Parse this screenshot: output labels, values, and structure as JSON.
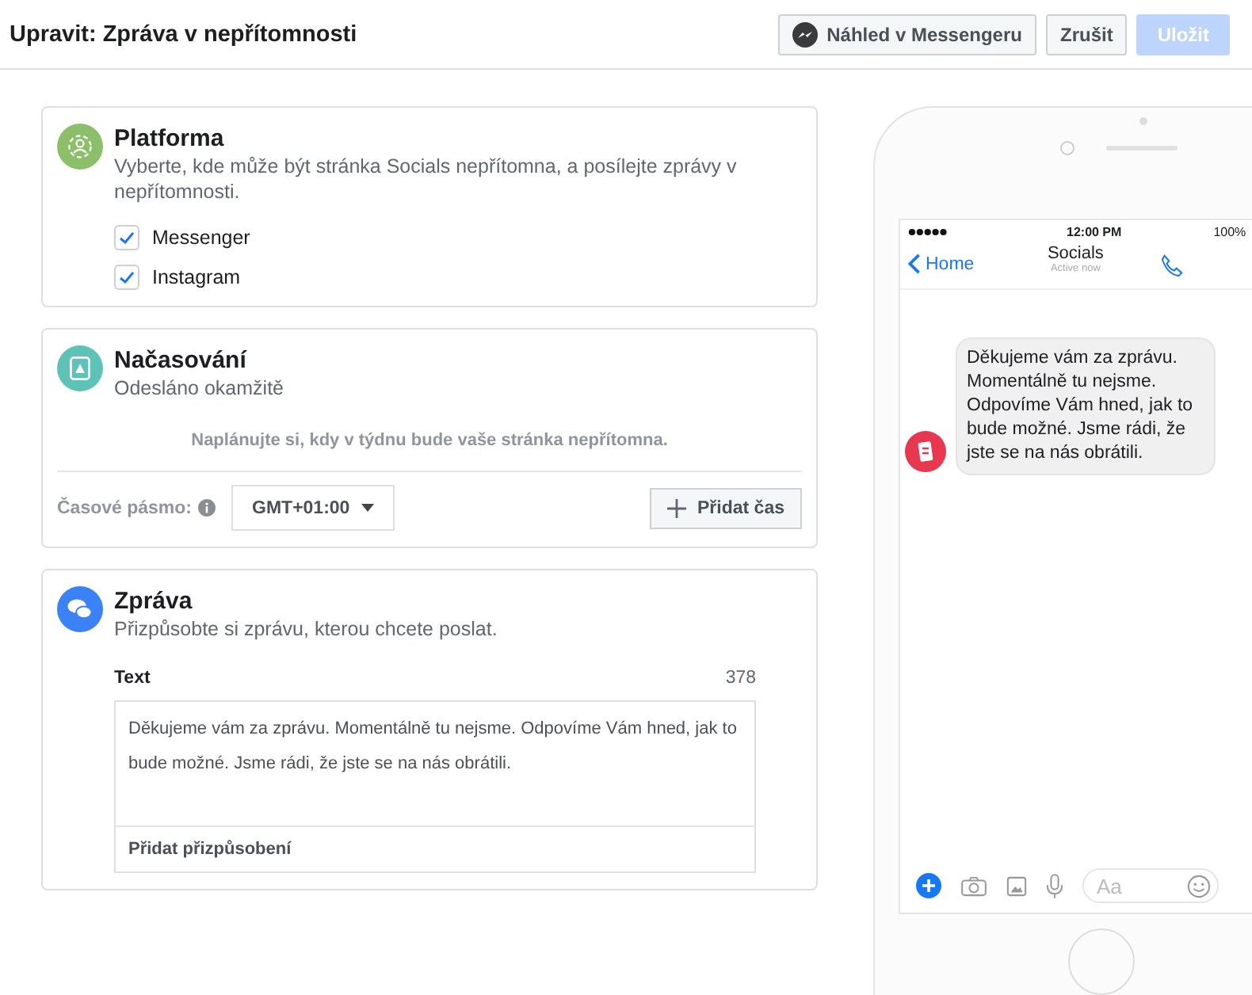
{
  "header": {
    "title": "Upravit: Zpráva v nepřítomnosti",
    "buttons": [
      {
        "label": "Náhled v Messengeru",
        "kind": "messenger",
        "disabled": false
      },
      {
        "label": "Zrušit",
        "kind": "secondary",
        "disabled": false
      },
      {
        "label": "Uložit",
        "kind": "primary",
        "disabled": true
      }
    ]
  },
  "platform": {
    "title": "Platforma",
    "color": "#8bbf6a",
    "description": "Vyberte, kde může být stránka Socials nepřítomna, a posílejte zprávy v nepřítomnosti.",
    "options": [
      {
        "label": "Messenger",
        "checked": true
      },
      {
        "label": "Instagram",
        "checked": true
      }
    ]
  },
  "schedule": {
    "title": "Načasování",
    "color": "#5ec2b7",
    "subtitle": "Odesláno okamžitě",
    "hint": "Naplánujte si, kdy v týdnu bude vaše stránka nepřítomna.",
    "timezone_label": "Časové pásmo:",
    "timezone": "GMT+01:00",
    "add_button": "Přidat čas"
  },
  "message": {
    "title": "Zpráva",
    "color": "#3b82f6",
    "subtitle": "Přizpůsobte si zprávu, kterou chcete poslat.",
    "field_label": "Text",
    "counter": "378",
    "value": "Děkujeme vám za zprávu. Momentálně tu nejsme. Odpovíme Vám hned, jak to bude možné. Jsme rádi, že jste se na nás obrátili.",
    "personalize": "Přidat přizpůsobení"
  },
  "phone": {
    "time": "12:00 PM",
    "battery": "100%",
    "back": "Home",
    "contact": "Socials",
    "status": "Active now",
    "bubble": "Děkujeme vám za zprávu. Momentálně tu nejsme. Odpovíme Vám hned, jak to bude možné. Jsme rádi, že jste se na nás obrátili.",
    "composer_placeholder": "Aa"
  }
}
